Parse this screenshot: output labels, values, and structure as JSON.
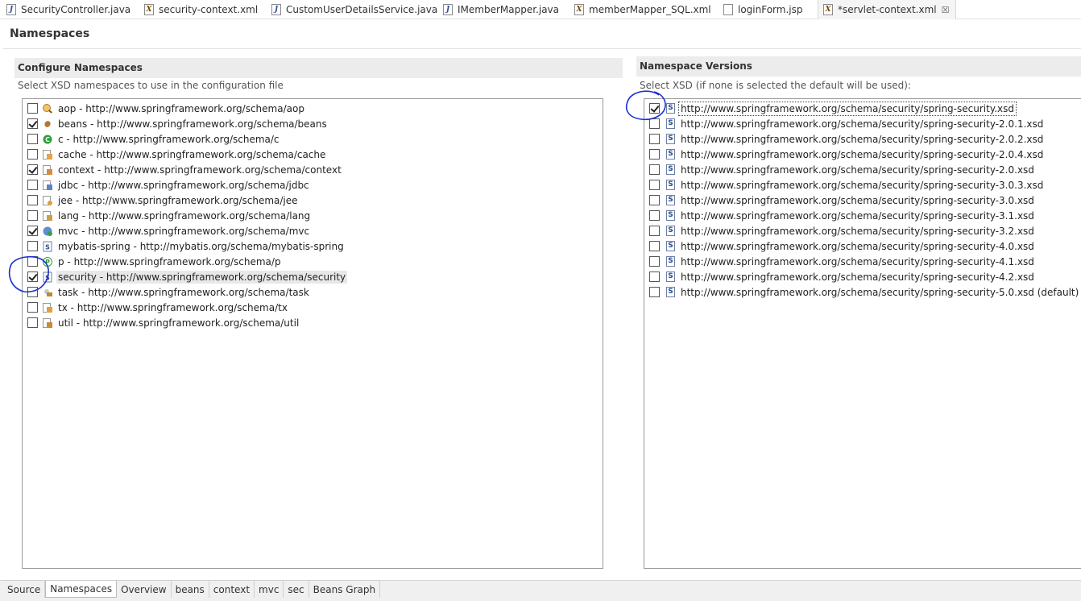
{
  "editor_tabs": [
    {
      "label": "SecurityController.java",
      "icon": "java-file-icon",
      "active": false
    },
    {
      "label": "security-context.xml",
      "icon": "xml-file-icon",
      "active": false
    },
    {
      "label": "CustomUserDetailsService.java",
      "icon": "java-file-icon",
      "active": false
    },
    {
      "label": "IMemberMapper.java",
      "icon": "java-file-icon",
      "active": false
    },
    {
      "label": "memberMapper_SQL.xml",
      "icon": "xml-file-icon",
      "active": false
    },
    {
      "label": "loginForm.jsp",
      "icon": "jsp-file-icon",
      "active": false
    },
    {
      "label": "*servlet-context.xml",
      "icon": "xml-file-icon",
      "active": true,
      "close": "☒"
    }
  ],
  "page": {
    "title": "Namespaces"
  },
  "configure": {
    "title": "Configure Namespaces",
    "description": "Select XSD namespaces to use in the configuration file",
    "namespaces": [
      {
        "label": "aop - http://www.springframework.org/schema/aop",
        "checked": false,
        "icon": "aop-icon"
      },
      {
        "label": "beans - http://www.springframework.org/schema/beans",
        "checked": true,
        "icon": "beans-icon"
      },
      {
        "label": "c - http://www.springframework.org/schema/c",
        "checked": false,
        "icon": "c-namespace-icon"
      },
      {
        "label": "cache - http://www.springframework.org/schema/cache",
        "checked": false,
        "icon": "cache-icon"
      },
      {
        "label": "context - http://www.springframework.org/schema/context",
        "checked": true,
        "icon": "context-icon"
      },
      {
        "label": "jdbc - http://www.springframework.org/schema/jdbc",
        "checked": false,
        "icon": "jdbc-icon"
      },
      {
        "label": "jee - http://www.springframework.org/schema/jee",
        "checked": false,
        "icon": "jee-icon"
      },
      {
        "label": "lang - http://www.springframework.org/schema/lang",
        "checked": false,
        "icon": "lang-icon"
      },
      {
        "label": "mvc - http://www.springframework.org/schema/mvc",
        "checked": true,
        "icon": "mvc-icon"
      },
      {
        "label": "mybatis-spring - http://mybatis.org/schema/mybatis-spring",
        "checked": false,
        "icon": "mybatis-icon"
      },
      {
        "label": "p - http://www.springframework.org/schema/p",
        "checked": false,
        "icon": "p-namespace-icon"
      },
      {
        "label": "security - http://www.springframework.org/schema/security",
        "checked": true,
        "icon": "security-icon",
        "selected": true
      },
      {
        "label": "task - http://www.springframework.org/schema/task",
        "checked": false,
        "icon": "task-icon"
      },
      {
        "label": "tx - http://www.springframework.org/schema/tx",
        "checked": false,
        "icon": "tx-icon"
      },
      {
        "label": "util - http://www.springframework.org/schema/util",
        "checked": false,
        "icon": "util-icon"
      }
    ]
  },
  "versions": {
    "title": "Namespace Versions",
    "description": "Select XSD (if none is selected the default will be used):",
    "items": [
      {
        "label": "http://www.springframework.org/schema/security/spring-security.xsd",
        "checked": true,
        "focused": true
      },
      {
        "label": "http://www.springframework.org/schema/security/spring-security-2.0.1.xsd",
        "checked": false
      },
      {
        "label": "http://www.springframework.org/schema/security/spring-security-2.0.2.xsd",
        "checked": false
      },
      {
        "label": "http://www.springframework.org/schema/security/spring-security-2.0.4.xsd",
        "checked": false
      },
      {
        "label": "http://www.springframework.org/schema/security/spring-security-2.0.xsd",
        "checked": false
      },
      {
        "label": "http://www.springframework.org/schema/security/spring-security-3.0.3.xsd",
        "checked": false
      },
      {
        "label": "http://www.springframework.org/schema/security/spring-security-3.0.xsd",
        "checked": false
      },
      {
        "label": "http://www.springframework.org/schema/security/spring-security-3.1.xsd",
        "checked": false
      },
      {
        "label": "http://www.springframework.org/schema/security/spring-security-3.2.xsd",
        "checked": false
      },
      {
        "label": "http://www.springframework.org/schema/security/spring-security-4.0.xsd",
        "checked": false
      },
      {
        "label": "http://www.springframework.org/schema/security/spring-security-4.1.xsd",
        "checked": false
      },
      {
        "label": "http://www.springframework.org/schema/security/spring-security-4.2.xsd",
        "checked": false
      },
      {
        "label": "http://www.springframework.org/schema/security/spring-security-5.0.xsd (default)",
        "checked": false
      }
    ]
  },
  "bottom_tabs": [
    {
      "label": "Source",
      "active": false
    },
    {
      "label": "Namespaces",
      "active": true
    },
    {
      "label": "Overview",
      "active": false
    },
    {
      "label": "beans",
      "active": false
    },
    {
      "label": "context",
      "active": false
    },
    {
      "label": "mvc",
      "active": false
    },
    {
      "label": "sec",
      "active": false
    },
    {
      "label": "Beans Graph",
      "active": false
    }
  ],
  "annotation_color": "#1a2fd6"
}
